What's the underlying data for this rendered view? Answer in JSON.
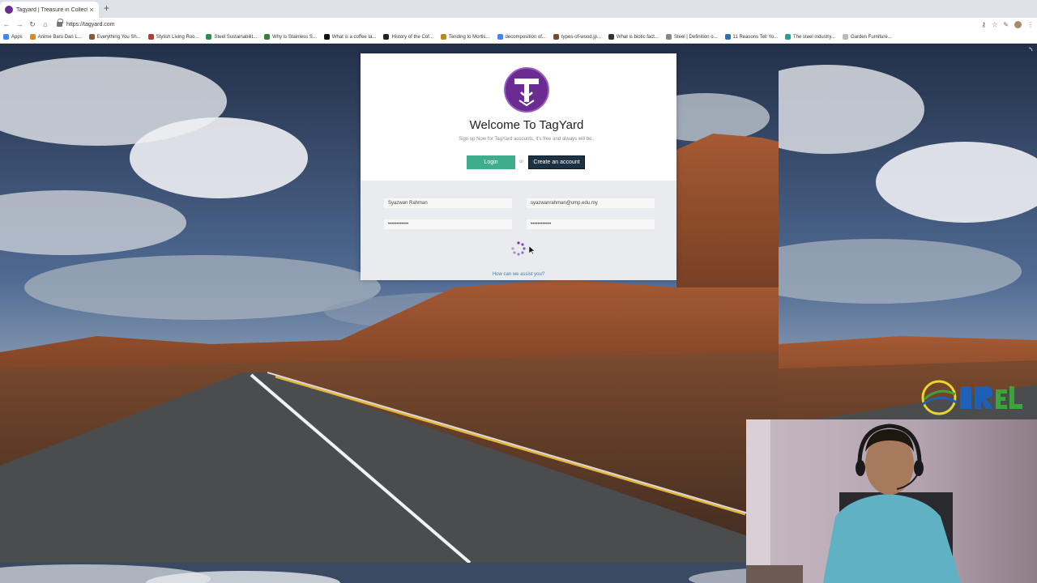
{
  "browser": {
    "tab_title": "Tagyard | Treasure in Collectio",
    "tab_close": "×",
    "new_tab": "+",
    "url": "https://tagyard.com",
    "bookmarks": [
      {
        "label": "Apps",
        "color": "#4285f4"
      },
      {
        "label": "Anime Baru Dan L...",
        "color": "#e08a1e"
      },
      {
        "label": "Everything You Sh...",
        "color": "#8a5a3c"
      },
      {
        "label": "Stylish Living Roo...",
        "color": "#c0392b"
      },
      {
        "label": "Steel Sustainabilit...",
        "color": "#2e8b57"
      },
      {
        "label": "Why is Stainless S...",
        "color": "#3b7d3b"
      },
      {
        "label": "What is a coffee ta...",
        "color": "#111111"
      },
      {
        "label": "History of the Cof...",
        "color": "#222222"
      },
      {
        "label": "Tending to Mortis...",
        "color": "#b88a2a"
      },
      {
        "label": "decomposition of...",
        "color": "#4285f4"
      },
      {
        "label": "types-of-wood.jp...",
        "color": "#7a4a2a"
      },
      {
        "label": "What is biotic fact...",
        "color": "#333333"
      },
      {
        "label": "Steel | Definition o...",
        "color": "#888888"
      },
      {
        "label": "11 Reasons Tell Yo...",
        "color": "#2a6fb8"
      },
      {
        "label": "The steel industry...",
        "color": "#1ea0a0"
      },
      {
        "label": "Garden Furniture...",
        "color": "#bbbbbb"
      }
    ]
  },
  "card": {
    "title": "Welcome To TagYard",
    "subtitle": "Sign up Now for TagYard accounts, it's free and always will be..",
    "login_label": "Login",
    "or_label": "or",
    "create_label": "Create an account",
    "name_value": "Syazwan Rahman",
    "email_value": "syazwanrahman@ump.edu.my",
    "password_value": "••••••••••••",
    "confirm_value": "••••••••••••",
    "assist_link": "How can we assist you?"
  },
  "colors": {
    "login": "#3fac8c",
    "create": "#1d3145",
    "logo_purple": "#6b2c91"
  },
  "icons": [
    "back-icon",
    "forward-icon",
    "reload-icon",
    "home-icon",
    "lock-icon",
    "key-icon",
    "star-icon",
    "pen-icon",
    "avatar-icon",
    "menu-icon",
    "loading-spinner-icon",
    "cursor-icon"
  ]
}
